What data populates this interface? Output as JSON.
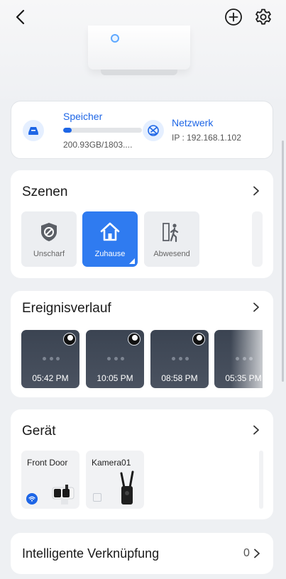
{
  "header": {
    "back_icon": "chevron-left-icon",
    "add_icon": "plus-circle-icon",
    "settings_icon": "gear-icon"
  },
  "status": {
    "storage": {
      "label": "Speicher",
      "value": "200.93GB/1803....",
      "used_fraction": 0.11,
      "icon": "storage-icon"
    },
    "network": {
      "label": "Netzwerk",
      "value": "IP : 192.168.1.102",
      "icon": "network-icon"
    }
  },
  "scenes": {
    "title": "Szenen",
    "items": [
      {
        "label": "Unscharf",
        "icon": "disarm-icon",
        "active": false
      },
      {
        "label": "Zuhause",
        "icon": "home-icon",
        "active": true
      },
      {
        "label": "Abwesend",
        "icon": "away-icon",
        "active": false
      }
    ]
  },
  "events": {
    "title": "Ereignisverlauf",
    "items": [
      {
        "time": "05:42 PM"
      },
      {
        "time": "10:05 PM"
      },
      {
        "time": "08:58 PM"
      },
      {
        "time": "05:35 PM"
      }
    ]
  },
  "devices": {
    "title": "Gerät",
    "items": [
      {
        "name": "Front Door",
        "status_icon": "wifi-icon"
      },
      {
        "name": "Kamera01",
        "status_icon": "offline-icon"
      }
    ]
  },
  "smart_link": {
    "title": "Intelligente Verknüpfung",
    "count": "0"
  },
  "colors": {
    "accent": "#1e66e6",
    "active_scene": "#2f7bf0",
    "background": "#eef0f3"
  }
}
